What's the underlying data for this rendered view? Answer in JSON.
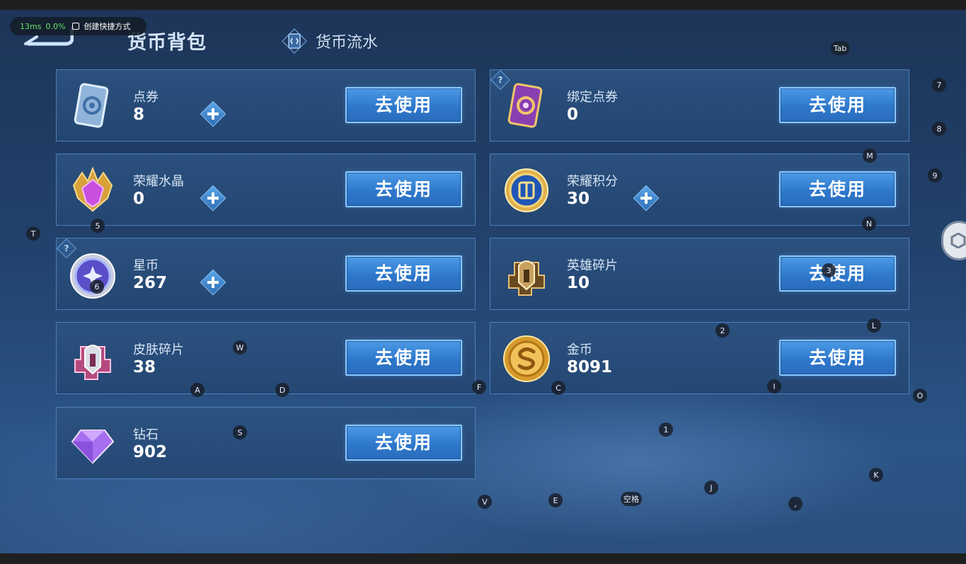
{
  "perf": {
    "latency": "13ms",
    "cpu": "0.0%",
    "shortcut_label": "创建快捷方式"
  },
  "header": {
    "title": "货币背包",
    "tab_flow_label": "货币流水"
  },
  "accent_colors": {
    "button": "#3a86d8",
    "button_border": "#8ccaff",
    "card": "#2c5280"
  },
  "currencies": [
    {
      "name": "点券",
      "value": "8",
      "icon": "ticket-blue-icon",
      "has_plus": true,
      "has_help": false,
      "button": "去使用"
    },
    {
      "name": "绑定点券",
      "value": "0",
      "icon": "ticket-purple-icon",
      "has_plus": false,
      "has_help": true,
      "button": "去使用"
    },
    {
      "name": "荣耀水晶",
      "value": "0",
      "icon": "crystal-icon",
      "has_plus": true,
      "has_help": false,
      "button": "去使用"
    },
    {
      "name": "荣耀积分",
      "value": "30",
      "icon": "points-coin-icon",
      "has_plus": true,
      "has_help": false,
      "button": "去使用"
    },
    {
      "name": "星币",
      "value": "267",
      "icon": "star-coin-icon",
      "has_plus": true,
      "has_help": true,
      "button": "去使用"
    },
    {
      "name": "英雄碎片",
      "value": "10",
      "icon": "hero-shard-icon",
      "has_plus": false,
      "has_help": false,
      "button": "去使用"
    },
    {
      "name": "皮肤碎片",
      "value": "38",
      "icon": "skin-shard-icon",
      "has_plus": false,
      "has_help": false,
      "button": "去使用"
    },
    {
      "name": "金币",
      "value": "8091",
      "icon": "gold-coin-icon",
      "has_plus": false,
      "has_help": false,
      "button": "去使用"
    },
    {
      "name": "钻石",
      "value": "902",
      "icon": "diamond-icon",
      "has_plus": false,
      "has_help": false,
      "button": "去使用"
    }
  ],
  "key_hints": [
    "Tab",
    "7",
    "8",
    "M",
    "9",
    "N",
    "T",
    "5",
    "6",
    "3",
    "2",
    "L",
    "W",
    "A",
    "D",
    "F",
    "C",
    "I",
    "O",
    "S",
    "1",
    "K",
    "J",
    "V",
    "E",
    "空格",
    ","
  ],
  "help_mark": "?"
}
